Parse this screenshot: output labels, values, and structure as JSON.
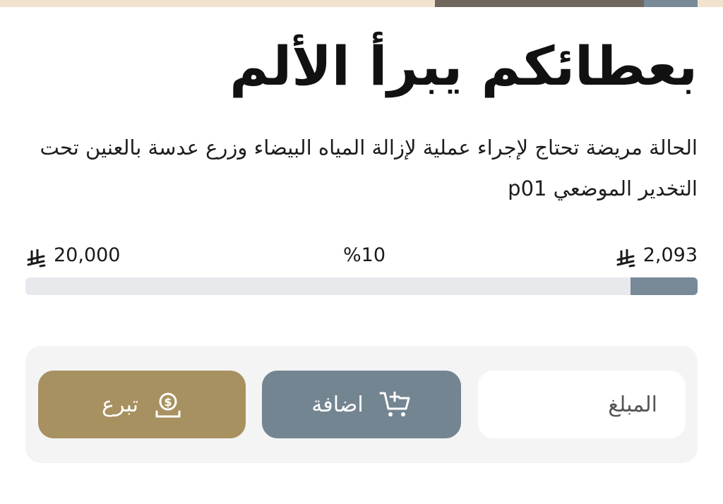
{
  "campaign": {
    "title": "بعطائكم يبرأ الألم",
    "description": "الحالة مريضة تحتاج لإجراء عملية لإزالة المياه البيضاء وزرع عدسة بالعنين تحت التخدير الموضعي p01"
  },
  "progress": {
    "collected": "2,093",
    "percent_label": "%10",
    "target": "20,000",
    "fraction_collected": 0.1
  },
  "currency_icon": "saudi-riyal-icon",
  "actions": {
    "amount_placeholder": "المبلغ",
    "add_label": "اضافة",
    "add_icon": "cart-plus-icon",
    "donate_label": "تبرع",
    "donate_icon": "coin-hand-icon"
  },
  "colors": {
    "accent_blue": "#738591",
    "accent_gold": "#a89160",
    "strip_beige": "#f1e3cd",
    "strip_dark": "#6f665e"
  }
}
